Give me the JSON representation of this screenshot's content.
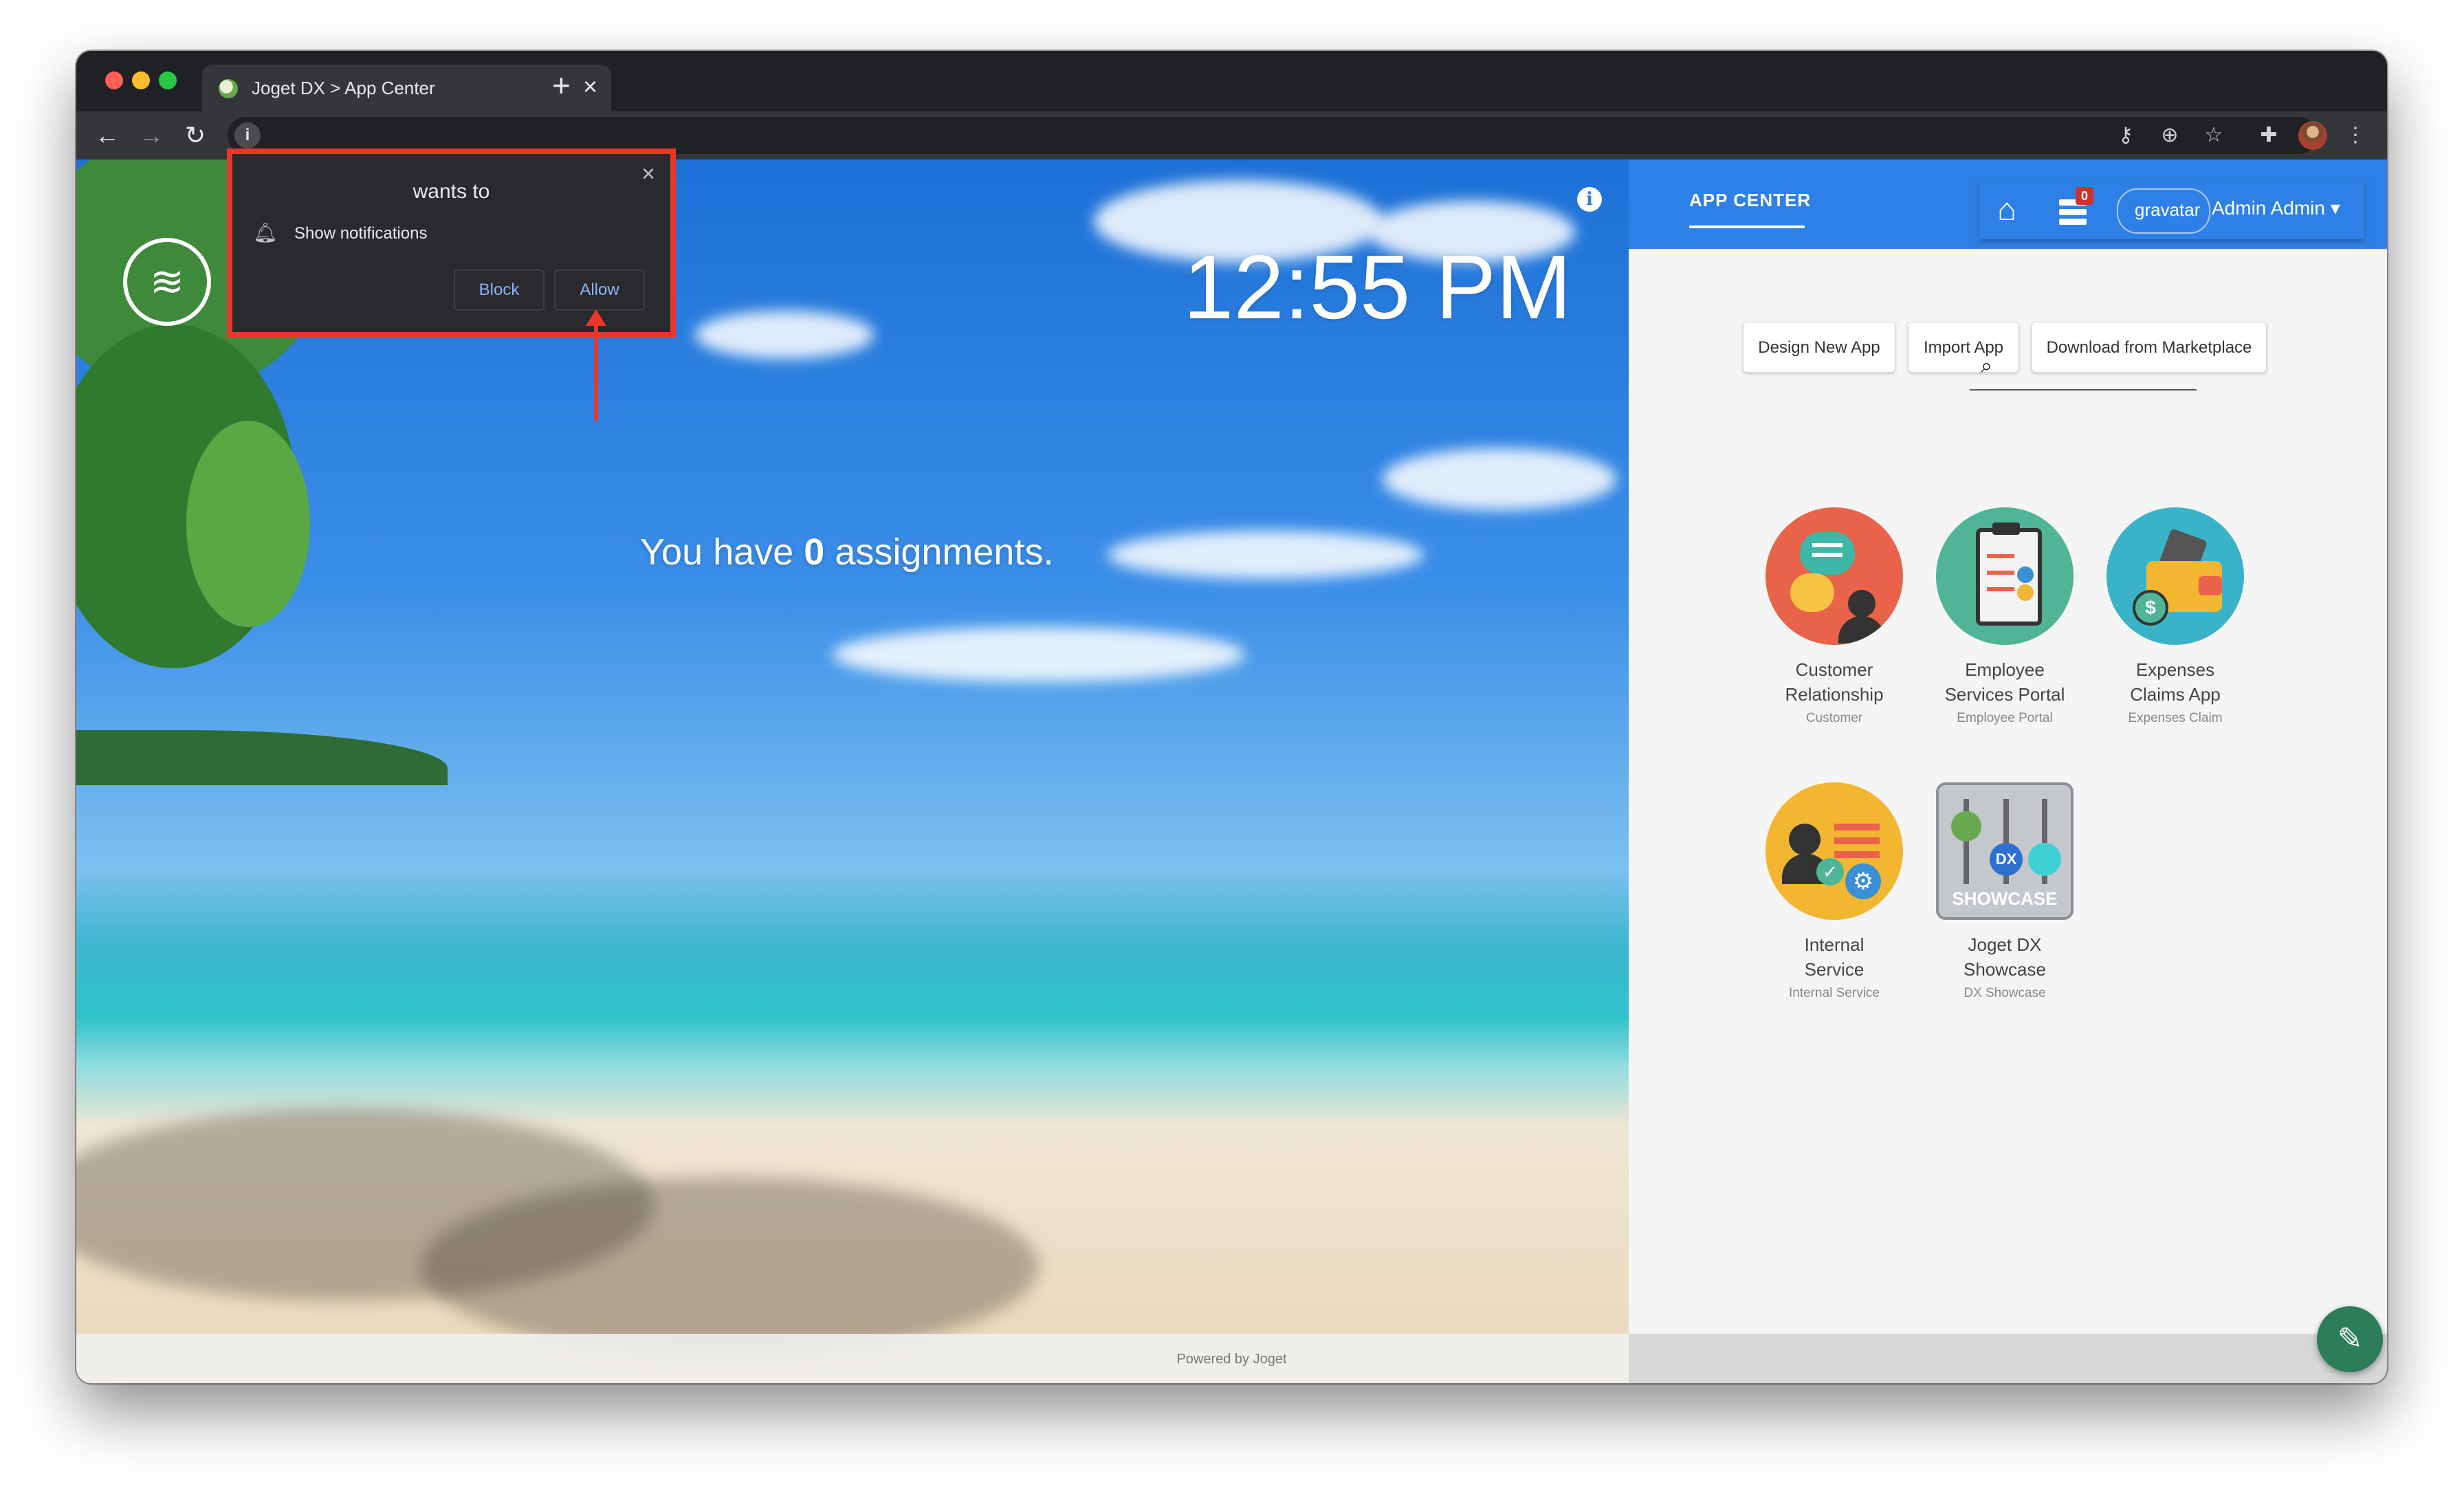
{
  "browser": {
    "tab_title": "Joget DX > App Center",
    "tab_close": "×",
    "new_tab": "+"
  },
  "notification": {
    "title": "wants to",
    "message": "Show notifications",
    "block_label": "Block",
    "allow_label": "Allow",
    "close": "×"
  },
  "hero": {
    "clock": "12:55 PM",
    "assignments_prefix": "You have",
    "assignments_count": "0",
    "assignments_suffix": "assignments."
  },
  "app_center": {
    "title": "APP CENTER",
    "inbox_count": "0",
    "gravatar_alt": "gravatar",
    "user_name": "Admin Admin ▾",
    "buttons": {
      "design": "Design New App",
      "import": "Import App",
      "marketplace": "Download from Marketplace"
    },
    "apps": [
      {
        "name_line1": "Customer",
        "name_line2": "Relationship",
        "subtitle": "Customer",
        "color": "#e8634a"
      },
      {
        "name_line1": "Employee",
        "name_line2": "Services Portal",
        "subtitle": "Employee Portal",
        "color": "#4fb596"
      },
      {
        "name_line1": "Expenses",
        "name_line2": "Claims App",
        "subtitle": "Expenses Claim",
        "color": "#3ab3c9"
      },
      {
        "name_line1": "Internal",
        "name_line2": "Service",
        "subtitle": "Internal Service",
        "color": "#f2b630"
      },
      {
        "name_line1": "Joget DX",
        "name_line2": "Showcase",
        "subtitle": "DX Showcase",
        "color": "#b9bcc2"
      }
    ]
  },
  "showcase_icon": {
    "badge": "DX",
    "label": "SHOWCASE"
  },
  "footer": {
    "powered_by": "Powered by Joget"
  },
  "colors": {
    "accent": "#2f80e6",
    "highlight": "#e8372a",
    "fab": "#2e7d5a"
  }
}
